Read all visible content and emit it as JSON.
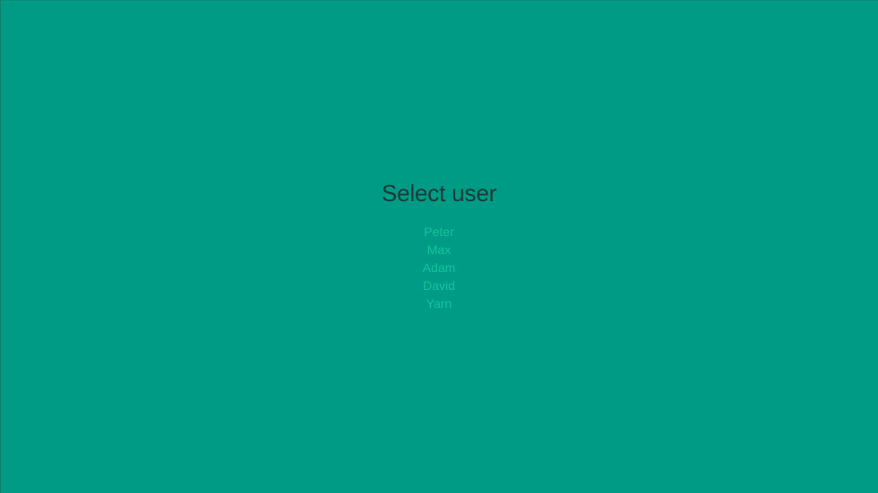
{
  "page": {
    "background_color": "#009b84",
    "title": "Select user",
    "title_color": "#1d3a3a",
    "link_color": "#14c39f"
  },
  "users": [
    {
      "label": "Peter"
    },
    {
      "label": "Max"
    },
    {
      "label": "Adam"
    },
    {
      "label": "David"
    },
    {
      "label": "Yarn"
    }
  ]
}
